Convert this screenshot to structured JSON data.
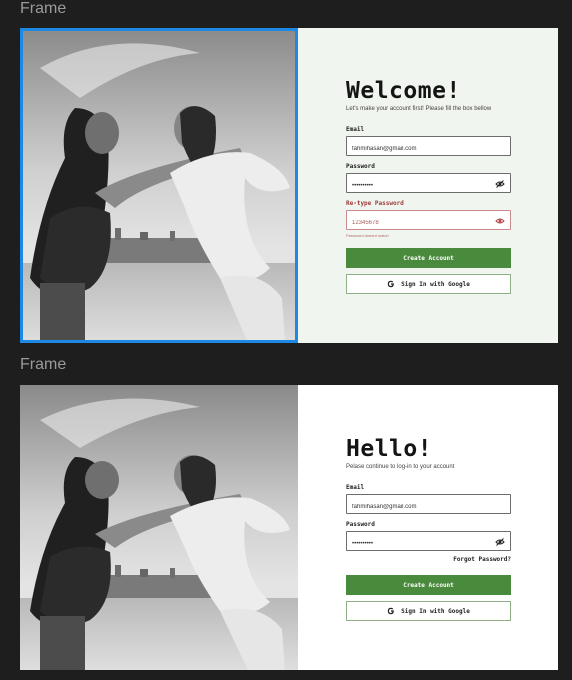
{
  "canvas": {
    "background": "#1e1e1e"
  },
  "frames": [
    {
      "label": "Frame",
      "panel_bg": "#f1f5ef",
      "heading": "Welcome!",
      "subtitle": "Let's make your account first! Please fill the box bellow",
      "email": {
        "label": "Email",
        "value": "fahmihasan@gmail.com"
      },
      "password": {
        "label": "Password",
        "value": "••••••••••"
      },
      "retype": {
        "label": "Re-type Password",
        "value": "12345678",
        "hint": "Password doesnt match"
      },
      "primary_button": "Create Account",
      "google_button": "Sign In with Google"
    },
    {
      "label": "Frame",
      "panel_bg": "#ffffff",
      "heading": "Hello!",
      "subtitle": "Pelase continue to log-in to your account",
      "email": {
        "label": "Email",
        "value": "fahmihasan@gmail.com"
      },
      "password": {
        "label": "Password",
        "value": "••••••••••"
      },
      "forgot": "Forgot Password?",
      "primary_button": "Create Account",
      "google_button": "Sign In with Google"
    }
  ],
  "colors": {
    "accent": "#4a8a3c",
    "error": "#9c3b3b",
    "selection": "#1e88e5"
  },
  "icons": [
    "eye-slash-icon",
    "eye-icon",
    "google-g-icon"
  ]
}
